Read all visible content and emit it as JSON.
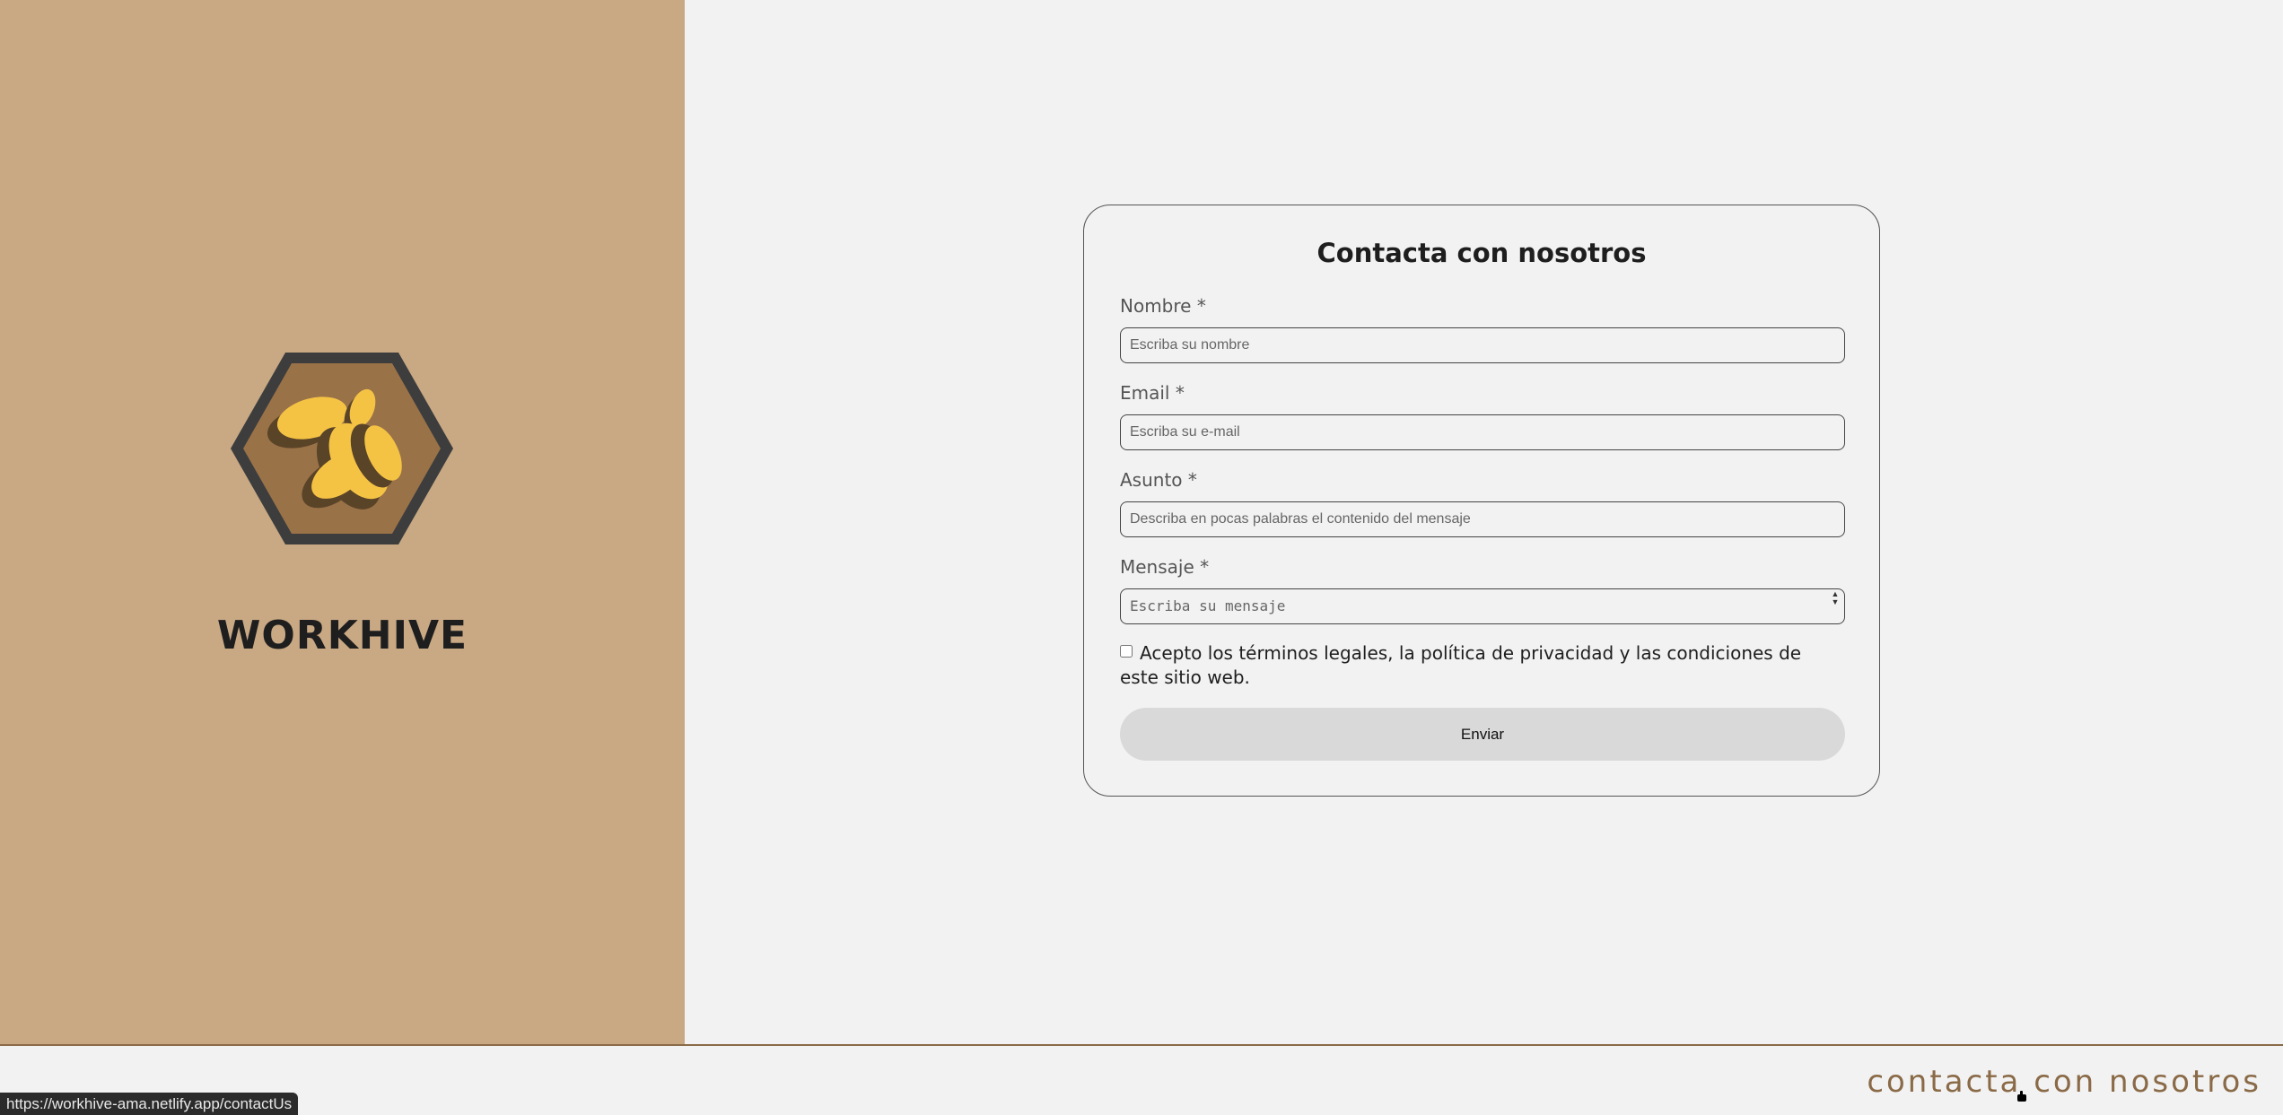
{
  "brand": {
    "name": "WORKHIVE",
    "logo_icon": "bee-hexagon-logo-icon",
    "colors": {
      "panel": "#c9a984",
      "hex_border": "#3d3d3d",
      "hex_fill": "#9a7248",
      "bee_yellow": "#f5c344",
      "bee_shadow": "#5a4428"
    }
  },
  "form": {
    "title": "Contacta con nosotros",
    "fields": {
      "name": {
        "label": "Nombre *",
        "placeholder": "Escriba su nombre"
      },
      "email": {
        "label": "Email *",
        "placeholder": "Escriba su e-mail"
      },
      "subject": {
        "label": "Asunto *",
        "placeholder": "Describa en pocas palabras el contenido del mensaje"
      },
      "message": {
        "label": "Mensaje *",
        "placeholder": "Escriba su mensaje"
      }
    },
    "terms_label": "Acepto los términos legales, la política de privacidad y las condiciones de este sitio web.",
    "submit_label": "Enviar"
  },
  "footer": {
    "contact_link": "contacta con nosotros",
    "accent_color": "#8a6a47"
  },
  "status_bar": {
    "url": "https://workhive-ama.netlify.app/contactUs"
  },
  "cursor": {
    "icon": "hand-pointer-icon"
  }
}
